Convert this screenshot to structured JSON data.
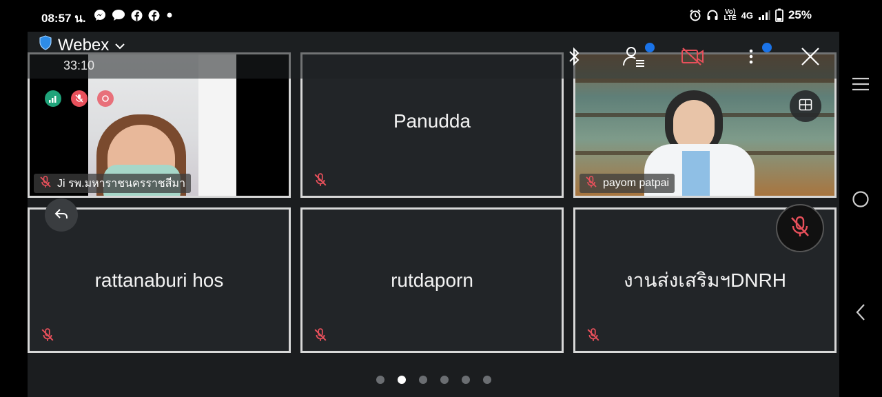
{
  "status_bar": {
    "time": "08:57 น.",
    "left_icons": [
      "messenger-icon",
      "chat-bubble-icon",
      "facebook-icon",
      "facebook-icon",
      "dot-icon"
    ],
    "right_icons": [
      "alarm-icon",
      "headphones-icon",
      "volte-icon",
      "4g-icon",
      "signal-icon",
      "battery-icon"
    ],
    "network_label": "4G",
    "volte_line1": "Vo)",
    "volte_line2": "LTE",
    "battery": "25%"
  },
  "header": {
    "app_name": "Webex",
    "meeting_timer": "33:10",
    "icons": [
      "shield-icon",
      "chevron-down-icon",
      "bluetooth-icon",
      "participants-icon",
      "video-off-icon",
      "more-icon",
      "close-icon"
    ]
  },
  "tiles": [
    {
      "name": "Ji รพ.มหาราชนครราชสีมา",
      "type": "video",
      "muted": true
    },
    {
      "name": "Panudda",
      "type": "name",
      "muted": true
    },
    {
      "name": "payom patpai",
      "type": "video",
      "muted": true
    },
    {
      "name": "rattanaburi hos",
      "type": "name",
      "muted": true
    },
    {
      "name": "rutdaporn",
      "type": "name",
      "muted": true
    },
    {
      "name": "งานส่งเสริมฯDNRH",
      "type": "name",
      "muted": true
    }
  ],
  "controls": {
    "back_button": "back-icon",
    "layout_button": "grid-layout-icon",
    "mute_button": "mic-off-icon"
  },
  "pager": {
    "pages": 6,
    "current": 2
  },
  "colors": {
    "accent_blue": "#1a73e8",
    "mute_red": "#e8505b",
    "tile_bg": "#222528",
    "tile_border": "#d8d8d8"
  }
}
